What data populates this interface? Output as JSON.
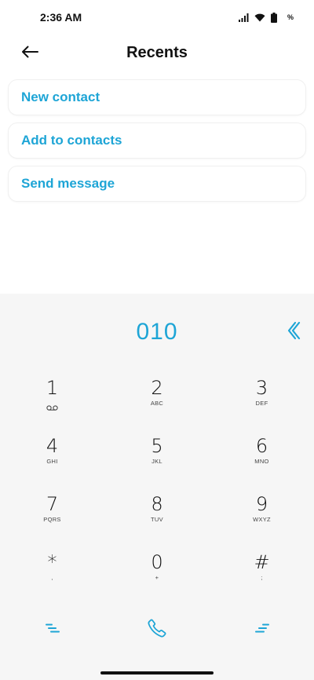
{
  "status_bar": {
    "time": "2:36 AM",
    "battery_text": "%",
    "icons": [
      "signal-icon",
      "wifi-icon",
      "battery-icon"
    ]
  },
  "header": {
    "title": "Recents",
    "back_icon": "arrow-left-icon"
  },
  "actions": [
    {
      "label": "New contact"
    },
    {
      "label": "Add to contacts"
    },
    {
      "label": "Send message"
    }
  ],
  "dialpad": {
    "number": "010",
    "erase_icon": "backspace-chevron-icon",
    "keys": [
      {
        "digit": "1",
        "letters": ""
      },
      {
        "digit": "2",
        "letters": "ABC"
      },
      {
        "digit": "3",
        "letters": "DEF"
      },
      {
        "digit": "4",
        "letters": "GHI"
      },
      {
        "digit": "5",
        "letters": "JKL"
      },
      {
        "digit": "6",
        "letters": "MNO"
      },
      {
        "digit": "7",
        "letters": "PQRS"
      },
      {
        "digit": "8",
        "letters": "TUV"
      },
      {
        "digit": "9",
        "letters": "WXYZ"
      },
      {
        "digit": "*",
        "letters": ","
      },
      {
        "digit": "0",
        "letters": "+"
      },
      {
        "digit": "#",
        "letters": ";"
      }
    ],
    "bottom": [
      "menu-left-icon",
      "phone-call-icon",
      "menu-right-icon"
    ]
  },
  "colors": {
    "accent": "#1ea5d6",
    "dialpad_bg": "#f6f6f6",
    "text": "#111111"
  }
}
